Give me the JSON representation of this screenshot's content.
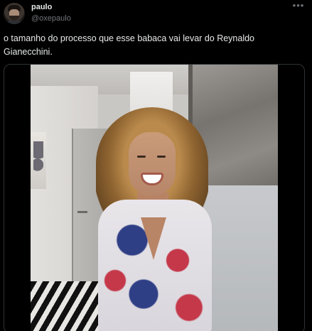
{
  "tweet": {
    "author_name": "paulo",
    "author_handle": "@oxepaulo",
    "text": "o tamanho do processo que esse babaca vai levar do Reynaldo Gianecchini.",
    "more_icon": "more-horizontal-icon"
  }
}
